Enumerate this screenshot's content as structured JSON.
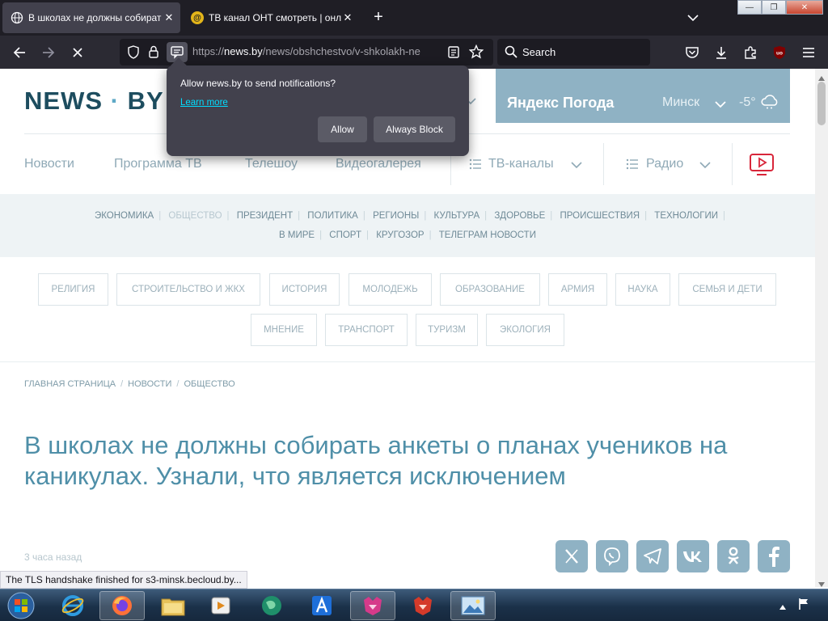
{
  "browser": {
    "tabs": [
      {
        "title": "В школах не должны собират",
        "active": true
      },
      {
        "title": "ТВ канал ОНТ смотреть | онла",
        "active": false
      }
    ],
    "favicon_ont": "@",
    "new_tab_label": "+",
    "close_glyph": "✕",
    "window_buttons": [
      "—",
      "❐",
      "✕"
    ],
    "url_prefix": "https://",
    "url_host": "news.by",
    "url_path": "/news/obshchestvo/v-shkolakh-ne",
    "search_placeholder": "Search",
    "extension_badge": "uo"
  },
  "popup": {
    "message": "Allow news.by to send notifications?",
    "learn_more": "Learn more",
    "allow": "Allow",
    "block": "Always Block"
  },
  "site": {
    "logo_left": "NEWS",
    "logo_dot": "·",
    "logo_right": "BY",
    "weather": {
      "title": "Яндекс Погода",
      "city": "Минск",
      "temp": "-5°"
    },
    "nav": [
      "Новости",
      "Программа ТВ",
      "Телешоу",
      "Видеогалерея"
    ],
    "nav_dropdowns": [
      "ТВ-каналы",
      "Радио"
    ],
    "rubrics_row1": [
      "ЭКОНОМИКА",
      "ОБЩЕСТВО",
      "ПРЕЗИДЕНТ",
      "ПОЛИТИКА",
      "РЕГИОНЫ",
      "КУЛЬТУРА",
      "ЗДОРОВЬЕ",
      "ПРОИСШЕСТВИЯ",
      "ТЕХНОЛОГИИ"
    ],
    "rubrics_row2": [
      "В МИРЕ",
      "СПОРТ",
      "КРУГОЗОР",
      "ТЕЛЕГРАМ НОВОСТИ"
    ],
    "tags_row1": [
      "РЕЛИГИЯ",
      "СТРОИТЕЛЬСТВО И ЖКХ",
      "ИСТОРИЯ",
      "МОЛОДЕЖЬ",
      "ОБРАЗОВАНИЕ",
      "АРМИЯ",
      "НАУКА",
      "СЕМЬЯ И ДЕТИ"
    ],
    "tags_row2": [
      "МНЕНИЕ",
      "ТРАНСПОРТ",
      "ТУРИЗМ",
      "ЭКОЛОГИЯ"
    ],
    "breadcrumbs": [
      "ГЛАВНАЯ СТРАНИЦА",
      "НОВОСТИ",
      "ОБЩЕСТВО"
    ],
    "headline": "В школах не должны собирать анкеты о планах учеников на каникулах. Узнали, что является исключением",
    "age": "3 часа назад",
    "share": [
      "x-icon",
      "viber-icon",
      "telegram-icon",
      "vk-icon",
      "ok-icon",
      "facebook-icon"
    ]
  },
  "status_text": "The TLS handshake finished for s3-minsk.becloud.by...",
  "colors": {
    "accent": "#4f8fa8",
    "brand_dark": "#1d4d5f",
    "weather_bg": "#8fb2c4",
    "youtube_red": "#d8263a"
  }
}
